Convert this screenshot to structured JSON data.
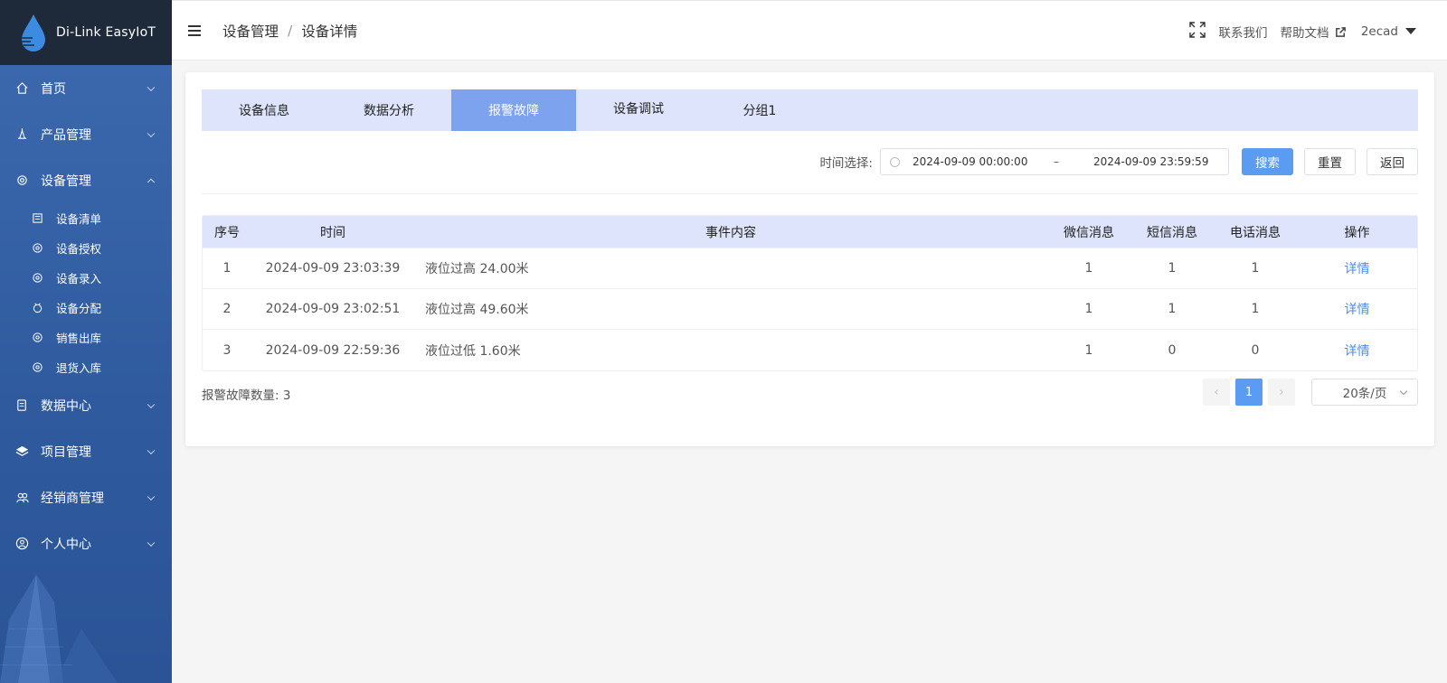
{
  "app": {
    "title": "Di-Link EasyIoT"
  },
  "sidebar": {
    "menu": [
      {
        "label": "首页",
        "icon": "home-icon",
        "expanded": false
      },
      {
        "label": "产品管理",
        "icon": "product-icon",
        "expanded": false
      },
      {
        "label": "设备管理",
        "icon": "device-icon",
        "expanded": true
      },
      {
        "label": "数据中心",
        "icon": "data-icon",
        "expanded": false
      },
      {
        "label": "项目管理",
        "icon": "layers-icon",
        "expanded": false
      },
      {
        "label": "经销商管理",
        "icon": "dealer-icon",
        "expanded": false
      },
      {
        "label": "个人中心",
        "icon": "user-icon",
        "expanded": false
      }
    ],
    "device_submenu": [
      "设备清单",
      "设备授权",
      "设备录入",
      "设备分配",
      "销售出库",
      "退货入库"
    ]
  },
  "header": {
    "breadcrumb": [
      "设备管理",
      "设备详情"
    ],
    "contact": "联系我们",
    "help": "帮助文档",
    "user": "2ecad"
  },
  "tabs": [
    {
      "label": "设备信息",
      "active": false
    },
    {
      "label": "数据分析",
      "active": false
    },
    {
      "label": "报警故障",
      "active": true
    },
    {
      "label": "设备调试",
      "active": false
    },
    {
      "label": "分组1",
      "active": false
    }
  ],
  "filter": {
    "label": "时间选择:",
    "start": "2024-09-09 00:00:00",
    "separator": "–",
    "end": "2024-09-09 23:59:59",
    "search": "搜索",
    "reset": "重置",
    "back": "返回"
  },
  "table": {
    "headers": [
      "序号",
      "时间",
      "事件内容",
      "微信消息",
      "短信消息",
      "电话消息",
      "操作"
    ],
    "rows": [
      {
        "no": "1",
        "time": "2024-09-09 23:03:39",
        "event": "液位过高 24.00米",
        "wechat": "1",
        "sms": "1",
        "phone": "1",
        "action": "详情"
      },
      {
        "no": "2",
        "time": "2024-09-09 23:02:51",
        "event": "液位过高 49.60米",
        "wechat": "1",
        "sms": "1",
        "phone": "1",
        "action": "详情"
      },
      {
        "no": "3",
        "time": "2024-09-09 22:59:36",
        "event": "液位过低 1.60米",
        "wechat": "1",
        "sms": "0",
        "phone": "0",
        "action": "详情"
      }
    ]
  },
  "footer": {
    "total": "报警故障数量: 3",
    "prev": "‹",
    "current_page": "1",
    "next": "›",
    "page_size": "20条/页"
  },
  "colors": {
    "accent": "#5b9cf3",
    "tab_bg": "#dde4fb",
    "tab_active": "#7ea3ee",
    "sidebar": "#2f5a9e",
    "logo_bar": "#1e2a3a"
  }
}
